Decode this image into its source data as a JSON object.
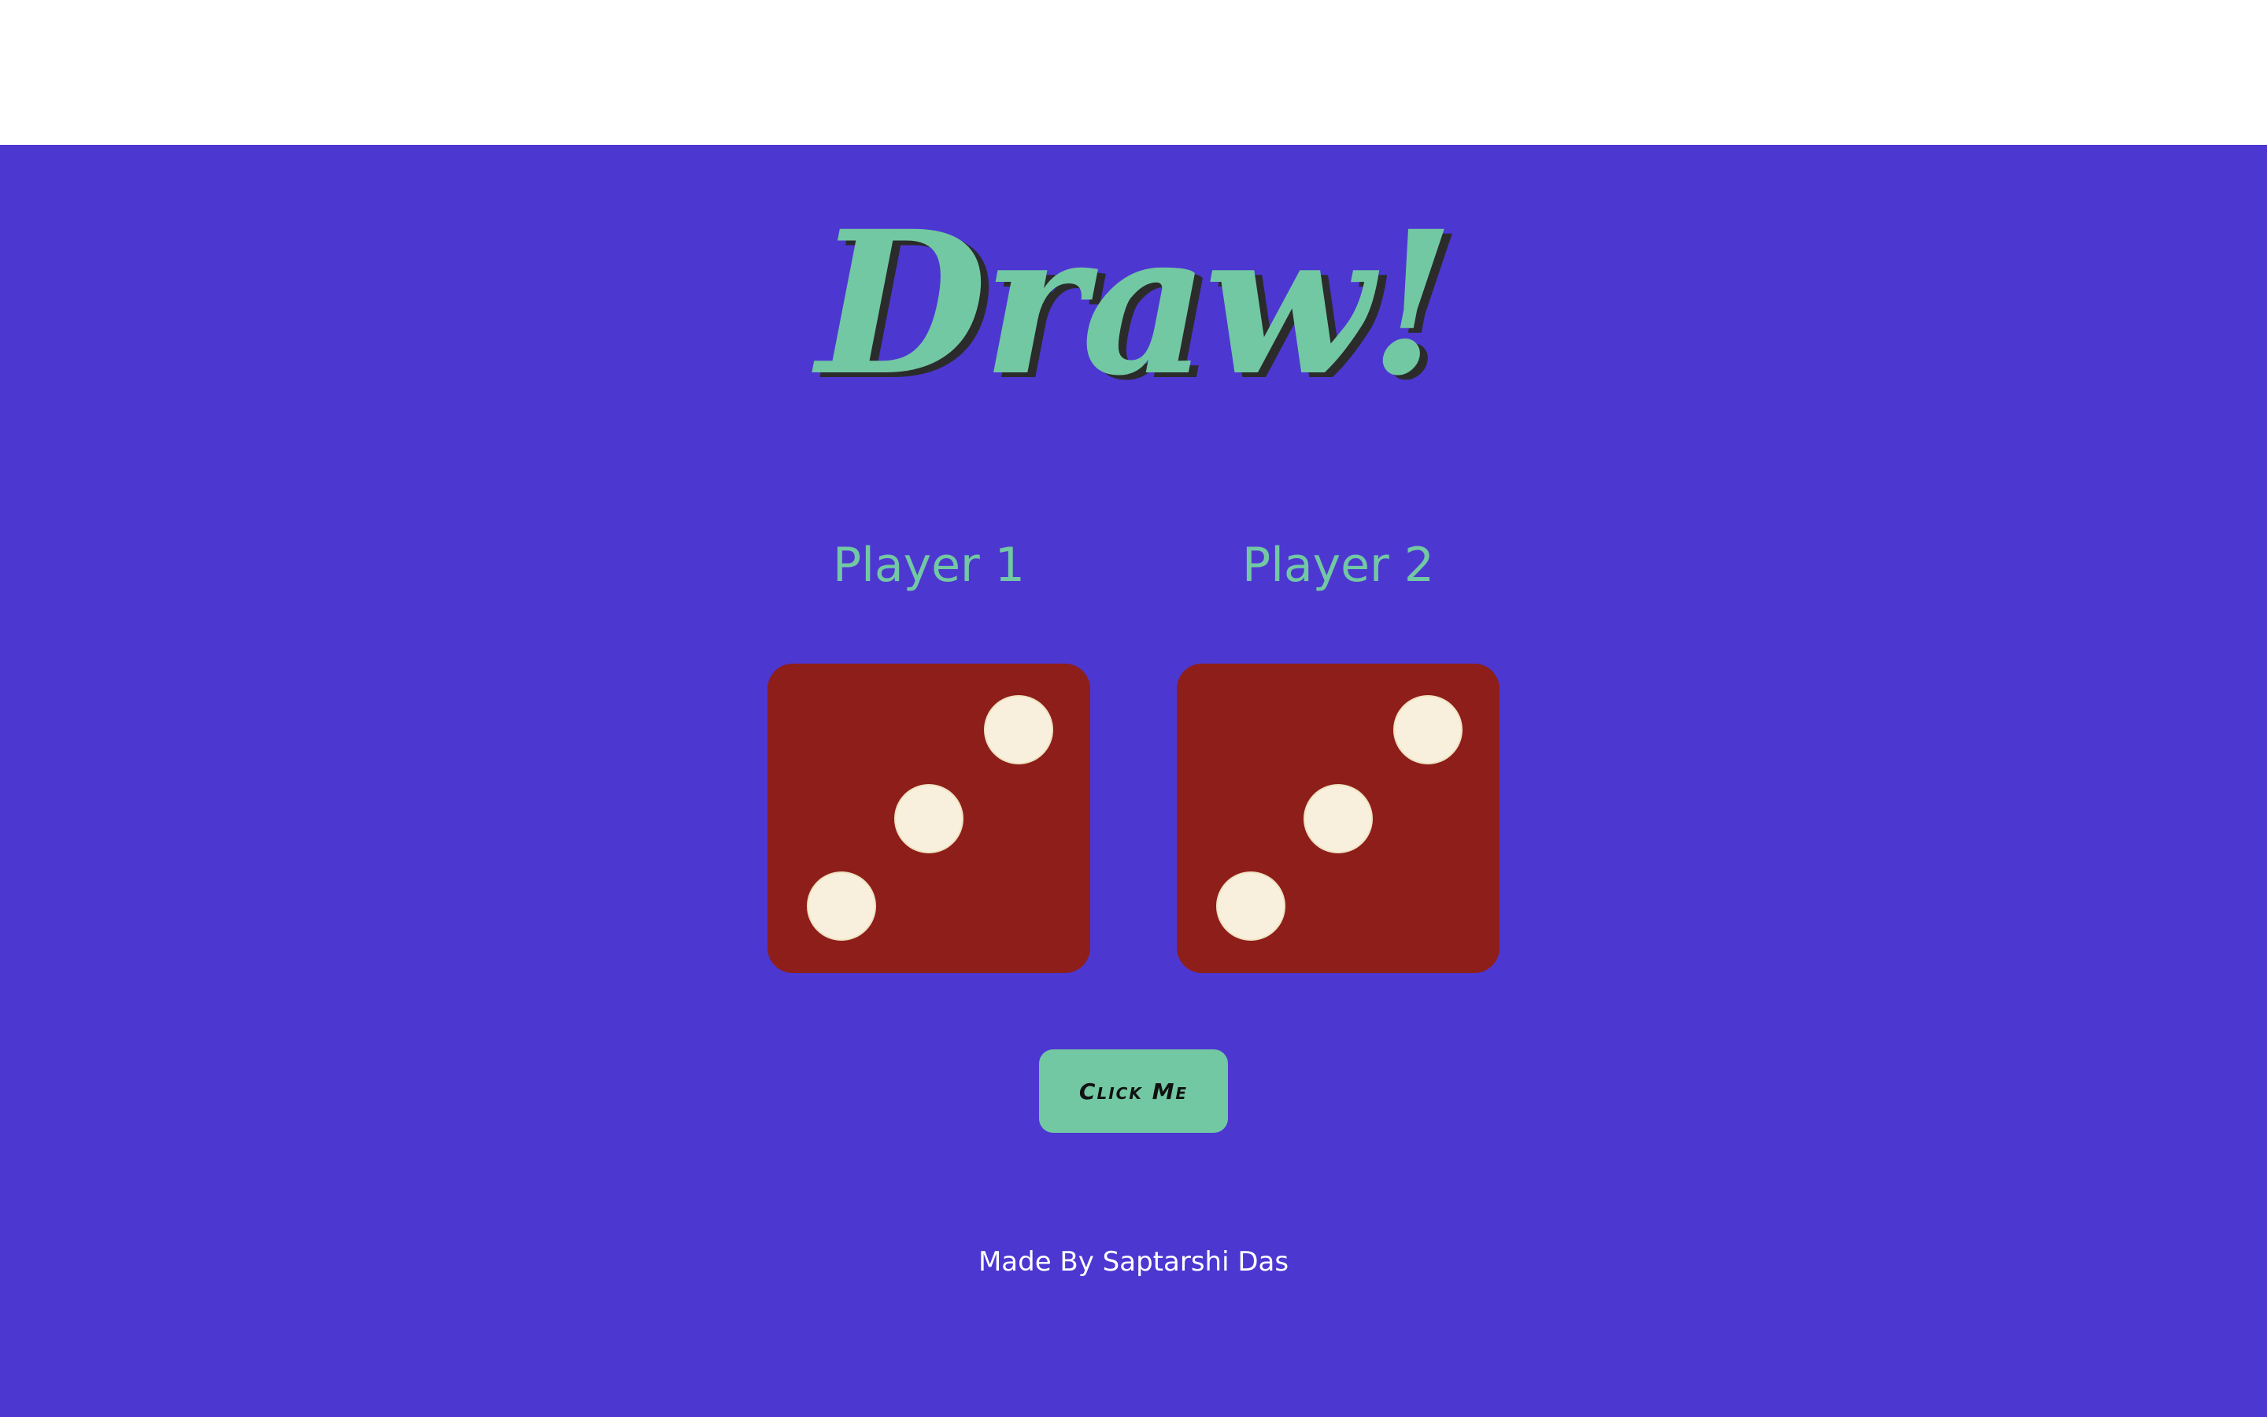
{
  "page": {
    "title": "Draw!",
    "footer_text": "Made By Saptarshi Das"
  },
  "players": [
    {
      "label": "Player 1",
      "die_value": 3
    },
    {
      "label": "Player 2",
      "die_value": 3
    }
  ],
  "controls": {
    "roll_button_label": "Click Me"
  },
  "colors": {
    "background": "#4d37d1",
    "accent": "#72c8a3",
    "die_face": "#8e1e19",
    "pip": "#f8f0dc"
  }
}
